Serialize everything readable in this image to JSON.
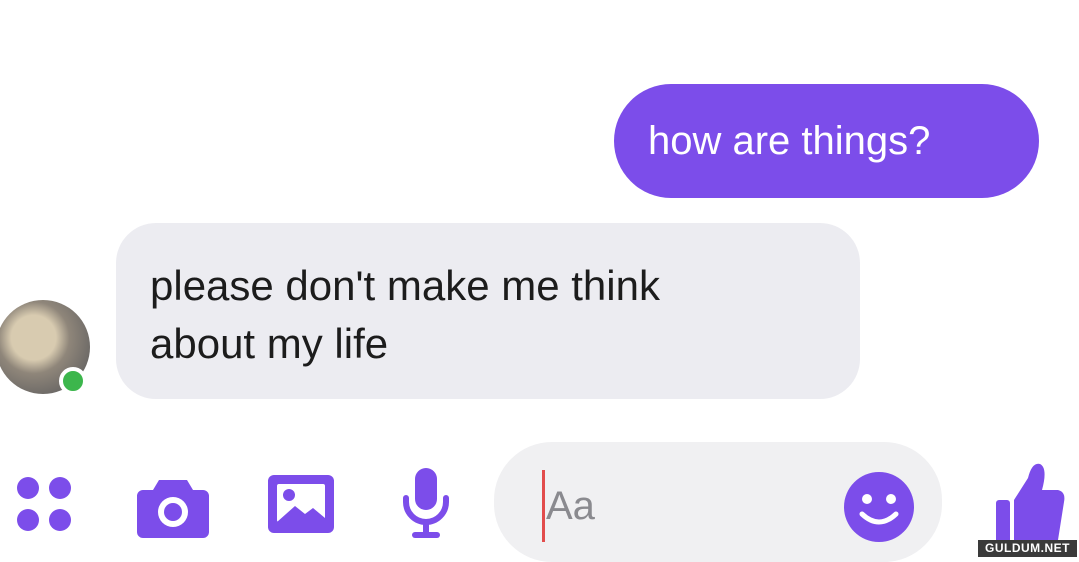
{
  "messages": [
    {
      "direction": "outgoing",
      "lines": [
        "how are things?"
      ]
    },
    {
      "direction": "incoming",
      "lines": [
        "please don't make me think",
        "about my life"
      ]
    }
  ],
  "composer": {
    "placeholder": "Aa",
    "icons": [
      "menu-dots-icon",
      "camera-icon",
      "image-icon",
      "microphone-icon",
      "emoji-icon",
      "thumbs-up-icon"
    ]
  },
  "avatar": {
    "status": "online"
  },
  "watermark": "GULDUM.NET",
  "colors": {
    "accent": "#7c4dea",
    "incoming_bubble": "#ececf1",
    "online": "#3cb64c"
  }
}
